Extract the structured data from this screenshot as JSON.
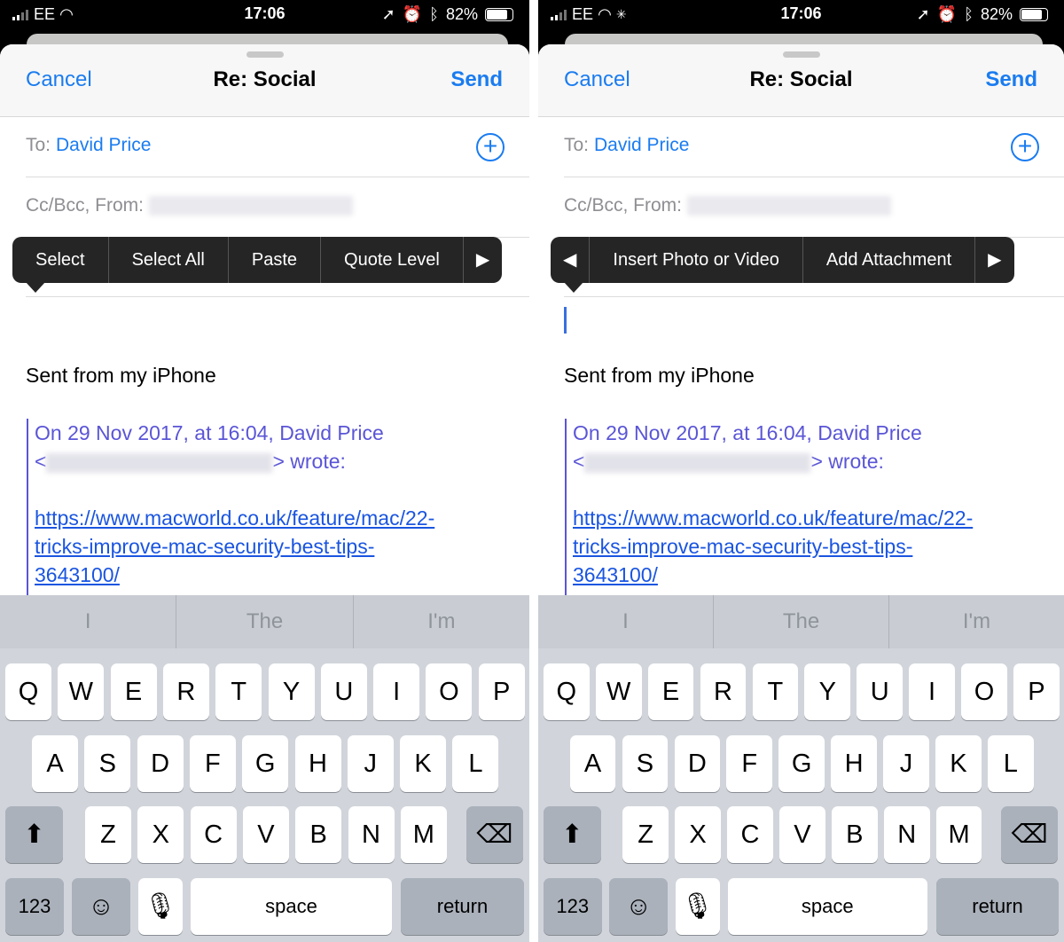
{
  "phones": [
    {
      "status": {
        "carrier": "EE",
        "time": "17:06",
        "battery": "82%",
        "battery_level": 0.82,
        "activity_spinner": false
      },
      "nav": {
        "cancel": "Cancel",
        "title": "Re: Social",
        "send": "Send"
      },
      "to": {
        "label": "To:",
        "value": "David Price"
      },
      "cc": {
        "label": "Cc/Bcc, From:"
      },
      "menu": {
        "left_arrow": false,
        "items": [
          "Select",
          "Select All",
          "Paste",
          "Quote Level"
        ],
        "right_arrow": true
      },
      "cursor_visible": false,
      "body": {
        "signature": "Sent from my iPhone",
        "quote_header": "On 29 Nov 2017, at 16:04, David Price",
        "quote_wrote": "> wrote:",
        "link_lines": [
          "https://www.macworld.co.uk/feature/mac/22-",
          "tricks-improve-mac-security-best-tips-",
          "3643100/"
        ]
      }
    },
    {
      "status": {
        "carrier": "EE",
        "time": "17:06",
        "battery": "82%",
        "battery_level": 0.82,
        "activity_spinner": true
      },
      "nav": {
        "cancel": "Cancel",
        "title": "Re: Social",
        "send": "Send"
      },
      "to": {
        "label": "To:",
        "value": "David Price"
      },
      "cc": {
        "label": "Cc/Bcc, From:"
      },
      "menu": {
        "left_arrow": true,
        "items": [
          "Insert Photo or Video",
          "Add Attachment"
        ],
        "right_arrow": true
      },
      "cursor_visible": true,
      "body": {
        "signature": "Sent from my iPhone",
        "quote_header": "On 29 Nov 2017, at 16:04, David Price",
        "quote_wrote": "> wrote:",
        "link_lines": [
          "https://www.macworld.co.uk/feature/mac/22-",
          "tricks-improve-mac-security-best-tips-",
          "3643100/"
        ]
      }
    }
  ],
  "keyboard": {
    "suggestions": [
      "I",
      "The",
      "I'm"
    ],
    "rows": [
      [
        "Q",
        "W",
        "E",
        "R",
        "T",
        "Y",
        "U",
        "I",
        "O",
        "P"
      ],
      [
        "A",
        "S",
        "D",
        "F",
        "G",
        "H",
        "J",
        "K",
        "L"
      ],
      [
        "Z",
        "X",
        "C",
        "V",
        "B",
        "N",
        "M"
      ]
    ],
    "numbers": "123",
    "space": "space",
    "return": "return"
  },
  "colors": {
    "accent": "#1a7cf0",
    "quote": "#5a55d6",
    "link": "#1a55e0",
    "keyboard_bg": "#d1d5db"
  }
}
